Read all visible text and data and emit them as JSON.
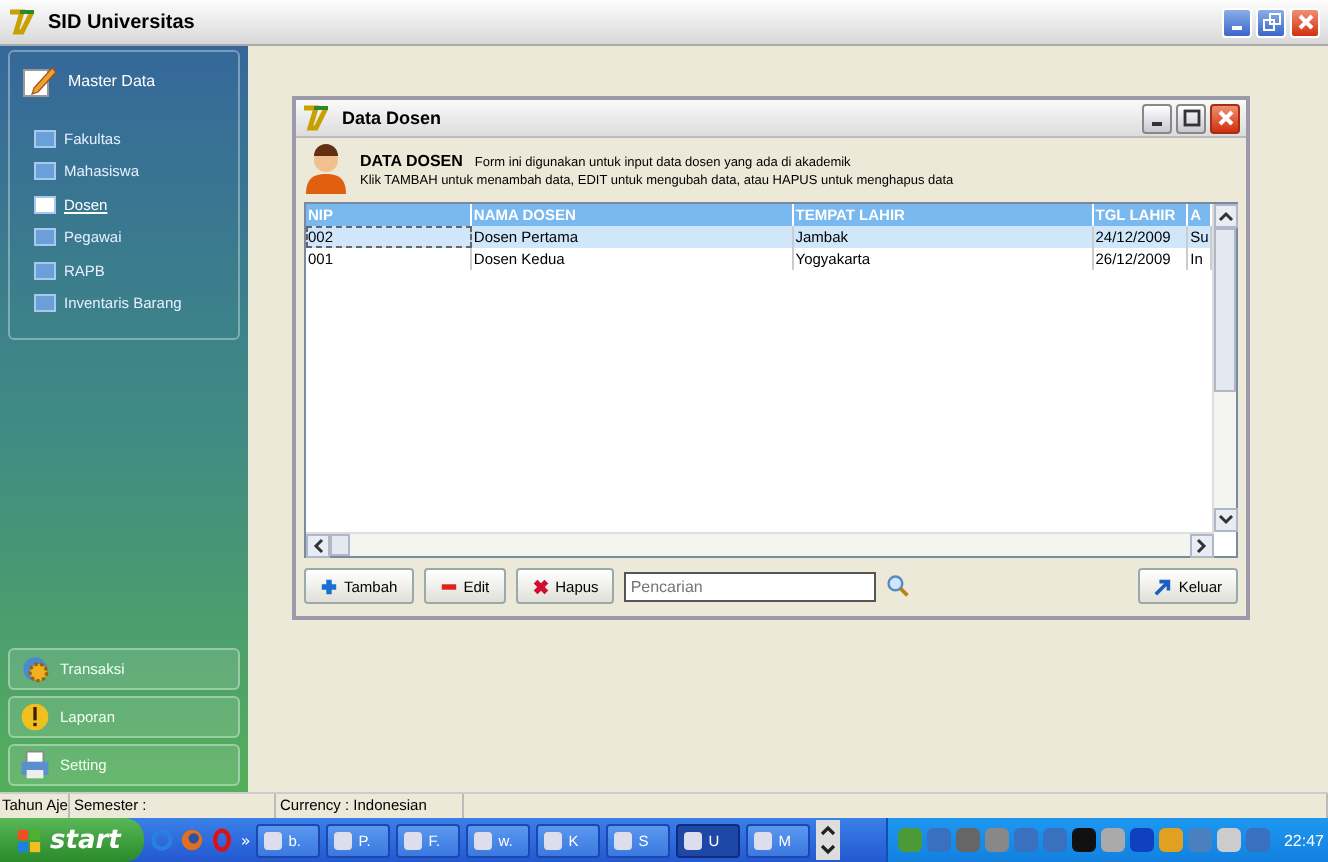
{
  "window": {
    "title": "SID Universitas"
  },
  "sidebar": {
    "header": "Master Data",
    "items": [
      {
        "label": "Fakultas",
        "selected": false
      },
      {
        "label": "Mahasiswa",
        "selected": false
      },
      {
        "label": "Dosen",
        "selected": true
      },
      {
        "label": "Pegawai",
        "selected": false
      },
      {
        "label": "RAPB",
        "selected": false
      },
      {
        "label": "Inventaris Barang",
        "selected": false
      }
    ],
    "sections": [
      {
        "label": "Transaksi",
        "kind": "gear"
      },
      {
        "label": "Laporan",
        "kind": "alert"
      },
      {
        "label": "Setting",
        "kind": "printer"
      }
    ]
  },
  "dialog": {
    "title": "Data Dosen",
    "heading": "DATA DOSEN",
    "description": "Form ini digunakan untuk input data dosen yang ada di akademik",
    "hint": "Klik TAMBAH untuk menambah data, EDIT untuk mengubah data, atau HAPUS untuk menghapus data",
    "table": {
      "columns": [
        "NIP",
        "NAMA DOSEN",
        "TEMPAT LAHIR",
        "TGL LAHIR",
        "A"
      ],
      "rows": [
        {
          "cells": [
            "002",
            "Dosen Pertama",
            "Jambak",
            "24/12/2009",
            "Su"
          ],
          "selected": true
        },
        {
          "cells": [
            "001",
            "Dosen Kedua",
            "Yogyakarta",
            "26/12/2009",
            "In"
          ],
          "selected": false
        }
      ]
    },
    "buttons": [
      {
        "label": "Tambah",
        "kind": "add"
      },
      {
        "label": "Edit",
        "kind": "edit"
      },
      {
        "label": "Hapus",
        "kind": "delete"
      }
    ],
    "search": {
      "placeholder": "Pencarian"
    },
    "exit_button": "Keluar"
  },
  "status_bar": [
    "Tahun Aje",
    "Semester :",
    "Currency : Indonesian"
  ],
  "taskbar": {
    "start": "start",
    "tasks": [
      {
        "label": "b.",
        "selected": false
      },
      {
        "label": "P.",
        "selected": false
      },
      {
        "label": "F.",
        "selected": false
      },
      {
        "label": "w.",
        "selected": false
      },
      {
        "label": "K",
        "selected": false
      },
      {
        "label": "S",
        "selected": false
      },
      {
        "label": "U",
        "selected": true
      },
      {
        "label": "M",
        "selected": false
      }
    ],
    "quick_launch_more": "»",
    "clock": "22:47"
  }
}
